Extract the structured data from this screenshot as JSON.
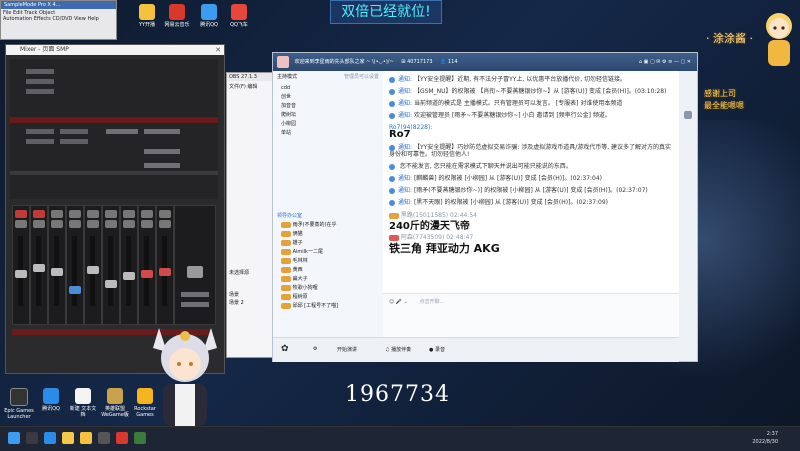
{
  "desktop": {
    "banner": "双倍已经就位!",
    "corner_label": "· 涂涂酱 ·",
    "corner_sign": "感谢上司\n最全能嗯嗯",
    "score": "1967734",
    "icons": [
      {
        "label": "YY开播",
        "color": "#f6c23e"
      },
      {
        "label": "网易云音乐",
        "color": "#d9382c"
      },
      {
        "label": "腾讯QQ",
        "color": "#3b9cf2"
      },
      {
        "label": "QQ飞车",
        "color": "#e8453c"
      },
      {
        "label": "Epic Games Launcher",
        "color": "#333333"
      },
      {
        "label": "腾讯QQ",
        "color": "#2b8be8"
      },
      {
        "label": "新建 文本文档",
        "color": "#f4f4f4"
      },
      {
        "label": "英雄联盟 WeGame版",
        "color": "#c9a24a"
      },
      {
        "label": "Rockstar Games",
        "color": "#f6b51f"
      }
    ]
  },
  "audio_app": {
    "title": "SampleMode Pro X 4...",
    "menu": [
      "File",
      "Edit",
      "Track",
      "Object",
      "Automation",
      "Effects",
      "CD/DVD",
      "View",
      "Help"
    ]
  },
  "mixer": {
    "title": "Mixer - 页面 SMP",
    "channels": [
      "Ch1",
      "Ch2",
      "Ch3",
      "Ch4",
      "Ch5",
      "Ch6",
      "Ch7",
      "Ch8",
      "Ch9",
      "Ch10",
      "Ch11"
    ]
  },
  "obs": {
    "title": "OBS 27.1.3",
    "menu": [
      "文件(F)",
      "编辑"
    ],
    "scene_panel": "未选择源",
    "scenes": [
      "场景",
      "场景 2"
    ]
  },
  "yy": {
    "channel_title": "欢迎来到李星雨的先头部队之家 ~ \\(•◡•)/~",
    "room_id": "40717173",
    "online": "114",
    "left_header": "主持模式",
    "left_header_right": "管理员可以设置",
    "tree": [
      "cdd",
      "创世",
      "加音音",
      "爬树坛",
      "小柳园",
      "单站"
    ],
    "online_label": "领导办公室",
    "users": [
      "雨矛(不要蒸的)在乎",
      "俩猫",
      "雄子",
      "Aimilk一二尾",
      "毛林林",
      "黄西",
      "扁大子",
      "牧歌小狗哩",
      "程树原",
      "邱邱 [工程号不了喵]"
    ],
    "messages": [
      {
        "name": "通知:",
        "text": "【YY安全提醒】近期, 有不法分子冒YY上, 以优惠平台放播代价, 切勿轻信链接。"
      },
      {
        "name": "通知:",
        "text": "【GSM_NU】的权限被 【肖衔~不要蒸糖银炒你~】从 [游客(U)] 变成 [会员(H)]。(03:10:28)"
      },
      {
        "name": "通知:",
        "text": "当前频道的模式是 主播模式。只有管理员可以发言。 [专服表] 对谁使用本频道"
      },
      {
        "name": "通知:",
        "text": "欢迎被管理员 [雨矛~不要蒸糖银炒你~] 小白 邀请到 [频率行公金] 频道。"
      },
      {
        "name": "Ro7(94(8228):",
        "text": "Ro7"
      },
      {
        "name": "通知:",
        "text": "【YY安全提醒】巧妙防范虚拟交易诈骗: 涉及虚拟游戏币道具/游戏代币等, 建议多了解对方的真实身份和可靠性。切勿轻信他人!"
      },
      {
        "name": "",
        "text": "您不能发言, 您只能在需求模式下聊天并说出可能只能说的东西。"
      },
      {
        "name": "通知:",
        "text": "[麒麟兽] 的权限被 [小柳园] 从 [游客(U)] 变成 [会员(H)]。(02:37:04)"
      },
      {
        "name": "通知:",
        "text": "[雨矛(不要蒸糖银炒你~)] 的权限被 [小柳园] 从 [游客(U)] 变成 [会员(H)]。(02:37:07)"
      },
      {
        "name": "通知:",
        "text": "[黑不天眼] 的权限被 [小柳园] 从 [游客(U)] 变成 [会员(H)]。(02:37:09)"
      }
    ],
    "chat_user1": "黑路(15011585) 02:44:54",
    "chat_big1": "240斤的漫天飞帝",
    "chat_user2": "阿森(7743509) 02:48:47",
    "chat_big2": "铁三角 拜亚动力 AKG",
    "input_placeholder": "点击开聊...",
    "bottom": [
      "开始演讲",
      "播放伴奏",
      "录音"
    ]
  },
  "taskbar": {
    "time": "2:37",
    "date": "2022/8/30"
  }
}
